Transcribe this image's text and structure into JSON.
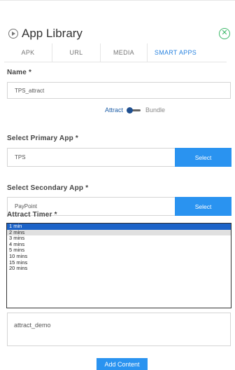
{
  "header": {
    "title": "App Library"
  },
  "tabs": [
    {
      "label": "APK"
    },
    {
      "label": "URL"
    },
    {
      "label": "MEDIA"
    },
    {
      "label": "SMART APPS",
      "active": true
    }
  ],
  "name": {
    "label": "Name *",
    "value": "TPS_attract"
  },
  "toggle": {
    "left_label": "Attract",
    "right_label": "Bundle",
    "state": "Attract"
  },
  "primary_app": {
    "label": "Select Primary App *",
    "value": "TPS",
    "button": "Select"
  },
  "secondary_app": {
    "label": "Select Secondary App *",
    "value": "PayPoint",
    "button": "Select"
  },
  "attract_timer": {
    "label": "Attract Timer *",
    "options": [
      "1 min",
      "2 mins",
      "3 mins",
      "4 mins",
      "5 mins",
      "10 mins",
      "15 mins",
      "20 mins"
    ],
    "selected": "1 min",
    "highlighted": "2 mins"
  },
  "description": {
    "value": "attract_demo"
  },
  "add_button": "Add Content",
  "colors": {
    "accent": "#2a93f0",
    "close": "#3db869",
    "selected": "#1c63c8"
  },
  "icons": {
    "title_icon": "play-circle-icon",
    "close_icon": "close-circle-icon"
  }
}
